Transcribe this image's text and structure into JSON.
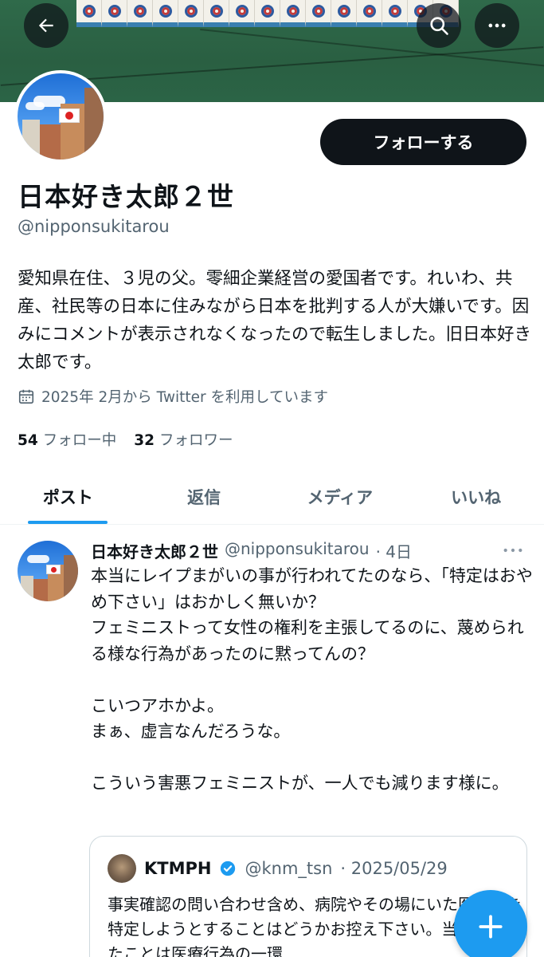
{
  "header": {
    "back_icon": "arrow-left-icon",
    "search_icon": "search-icon",
    "more_icon": "more-horizontal-icon"
  },
  "profile": {
    "display_name": "日本好き太郎２世",
    "handle": "@nipponsukitarou",
    "follow_label": "フォローする",
    "bio": "愛知県在住、３児の父。零細企業経営の愛国者です。れいわ、共産、社民等の日本に住みながら日本を批判する人が大嫌いです。因みにコメントが表示されなくなったので転生しました。旧日本好き太郎です。",
    "joined": "2025年 2月から Twitter を利用しています",
    "following_count": "54",
    "following_label": "フォロー中",
    "followers_count": "32",
    "followers_label": "フォロワー"
  },
  "tabs": [
    {
      "label": "ポスト",
      "active": true
    },
    {
      "label": "返信",
      "active": false
    },
    {
      "label": "メディア",
      "active": false
    },
    {
      "label": "いいね",
      "active": false
    }
  ],
  "tweet": {
    "name": "日本好き太郎２世",
    "handle": "@nipponsukitarou",
    "time": "· 4日",
    "body": "本当にレイプまがいの事が行われてたのなら、「特定はおやめ下さい」はおかしく無いか？\nフェミニストって女性の権利を主張してるのに、蔑められる様な行為があったのに黙ってんの？\n\nこいつアホかよ。\nまぁ、虚言なんだろうな。\n\nこういう害悪フェミニストが、一人でも減ります様に。"
  },
  "quote": {
    "name": "KTMPH",
    "handle": "@knm_tsn",
    "date": "· 2025/05/29",
    "body": "事実確認の問い合わせ含め、病院やその場にいた医療者を特定しようとすることはどうかお控え下さい。当時行われたことは医療行為の一環"
  },
  "colors": {
    "accent": "#1d9bf0",
    "text": "#0f1419",
    "muted": "#536471"
  }
}
